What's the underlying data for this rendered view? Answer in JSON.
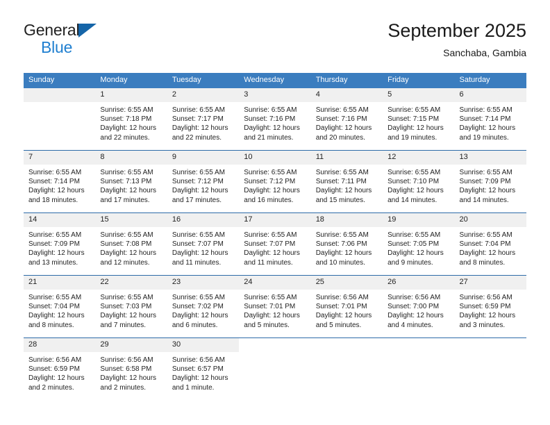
{
  "brand": {
    "name_part1": "General",
    "name_part2": "Blue",
    "logo_icon": "triangle-icon"
  },
  "header": {
    "title": "September 2025",
    "location": "Sanchaba, Gambia"
  },
  "colors": {
    "header_blue": "#3b7dbf",
    "rule_blue": "#2c6aa8",
    "daynum_band": "#f0f0f0",
    "brand_blue": "#1f7fd0",
    "text": "#222222"
  },
  "weekday_headers": [
    "Sunday",
    "Monday",
    "Tuesday",
    "Wednesday",
    "Thursday",
    "Friday",
    "Saturday"
  ],
  "weeks": [
    [
      {
        "day": "",
        "lines": []
      },
      {
        "day": "1",
        "lines": [
          "Sunrise: 6:55 AM",
          "Sunset: 7:18 PM",
          "Daylight: 12 hours",
          "and 22 minutes."
        ]
      },
      {
        "day": "2",
        "lines": [
          "Sunrise: 6:55 AM",
          "Sunset: 7:17 PM",
          "Daylight: 12 hours",
          "and 22 minutes."
        ]
      },
      {
        "day": "3",
        "lines": [
          "Sunrise: 6:55 AM",
          "Sunset: 7:16 PM",
          "Daylight: 12 hours",
          "and 21 minutes."
        ]
      },
      {
        "day": "4",
        "lines": [
          "Sunrise: 6:55 AM",
          "Sunset: 7:16 PM",
          "Daylight: 12 hours",
          "and 20 minutes."
        ]
      },
      {
        "day": "5",
        "lines": [
          "Sunrise: 6:55 AM",
          "Sunset: 7:15 PM",
          "Daylight: 12 hours",
          "and 19 minutes."
        ]
      },
      {
        "day": "6",
        "lines": [
          "Sunrise: 6:55 AM",
          "Sunset: 7:14 PM",
          "Daylight: 12 hours",
          "and 19 minutes."
        ]
      }
    ],
    [
      {
        "day": "7",
        "lines": [
          "Sunrise: 6:55 AM",
          "Sunset: 7:14 PM",
          "Daylight: 12 hours",
          "and 18 minutes."
        ]
      },
      {
        "day": "8",
        "lines": [
          "Sunrise: 6:55 AM",
          "Sunset: 7:13 PM",
          "Daylight: 12 hours",
          "and 17 minutes."
        ]
      },
      {
        "day": "9",
        "lines": [
          "Sunrise: 6:55 AM",
          "Sunset: 7:12 PM",
          "Daylight: 12 hours",
          "and 17 minutes."
        ]
      },
      {
        "day": "10",
        "lines": [
          "Sunrise: 6:55 AM",
          "Sunset: 7:12 PM",
          "Daylight: 12 hours",
          "and 16 minutes."
        ]
      },
      {
        "day": "11",
        "lines": [
          "Sunrise: 6:55 AM",
          "Sunset: 7:11 PM",
          "Daylight: 12 hours",
          "and 15 minutes."
        ]
      },
      {
        "day": "12",
        "lines": [
          "Sunrise: 6:55 AM",
          "Sunset: 7:10 PM",
          "Daylight: 12 hours",
          "and 14 minutes."
        ]
      },
      {
        "day": "13",
        "lines": [
          "Sunrise: 6:55 AM",
          "Sunset: 7:09 PM",
          "Daylight: 12 hours",
          "and 14 minutes."
        ]
      }
    ],
    [
      {
        "day": "14",
        "lines": [
          "Sunrise: 6:55 AM",
          "Sunset: 7:09 PM",
          "Daylight: 12 hours",
          "and 13 minutes."
        ]
      },
      {
        "day": "15",
        "lines": [
          "Sunrise: 6:55 AM",
          "Sunset: 7:08 PM",
          "Daylight: 12 hours",
          "and 12 minutes."
        ]
      },
      {
        "day": "16",
        "lines": [
          "Sunrise: 6:55 AM",
          "Sunset: 7:07 PM",
          "Daylight: 12 hours",
          "and 11 minutes."
        ]
      },
      {
        "day": "17",
        "lines": [
          "Sunrise: 6:55 AM",
          "Sunset: 7:07 PM",
          "Daylight: 12 hours",
          "and 11 minutes."
        ]
      },
      {
        "day": "18",
        "lines": [
          "Sunrise: 6:55 AM",
          "Sunset: 7:06 PM",
          "Daylight: 12 hours",
          "and 10 minutes."
        ]
      },
      {
        "day": "19",
        "lines": [
          "Sunrise: 6:55 AM",
          "Sunset: 7:05 PM",
          "Daylight: 12 hours",
          "and 9 minutes."
        ]
      },
      {
        "day": "20",
        "lines": [
          "Sunrise: 6:55 AM",
          "Sunset: 7:04 PM",
          "Daylight: 12 hours",
          "and 8 minutes."
        ]
      }
    ],
    [
      {
        "day": "21",
        "lines": [
          "Sunrise: 6:55 AM",
          "Sunset: 7:04 PM",
          "Daylight: 12 hours",
          "and 8 minutes."
        ]
      },
      {
        "day": "22",
        "lines": [
          "Sunrise: 6:55 AM",
          "Sunset: 7:03 PM",
          "Daylight: 12 hours",
          "and 7 minutes."
        ]
      },
      {
        "day": "23",
        "lines": [
          "Sunrise: 6:55 AM",
          "Sunset: 7:02 PM",
          "Daylight: 12 hours",
          "and 6 minutes."
        ]
      },
      {
        "day": "24",
        "lines": [
          "Sunrise: 6:55 AM",
          "Sunset: 7:01 PM",
          "Daylight: 12 hours",
          "and 5 minutes."
        ]
      },
      {
        "day": "25",
        "lines": [
          "Sunrise: 6:56 AM",
          "Sunset: 7:01 PM",
          "Daylight: 12 hours",
          "and 5 minutes."
        ]
      },
      {
        "day": "26",
        "lines": [
          "Sunrise: 6:56 AM",
          "Sunset: 7:00 PM",
          "Daylight: 12 hours",
          "and 4 minutes."
        ]
      },
      {
        "day": "27",
        "lines": [
          "Sunrise: 6:56 AM",
          "Sunset: 6:59 PM",
          "Daylight: 12 hours",
          "and 3 minutes."
        ]
      }
    ],
    [
      {
        "day": "28",
        "lines": [
          "Sunrise: 6:56 AM",
          "Sunset: 6:59 PM",
          "Daylight: 12 hours",
          "and 2 minutes."
        ]
      },
      {
        "day": "29",
        "lines": [
          "Sunrise: 6:56 AM",
          "Sunset: 6:58 PM",
          "Daylight: 12 hours",
          "and 2 minutes."
        ]
      },
      {
        "day": "30",
        "lines": [
          "Sunrise: 6:56 AM",
          "Sunset: 6:57 PM",
          "Daylight: 12 hours",
          "and 1 minute."
        ]
      },
      {
        "day": "",
        "lines": []
      },
      {
        "day": "",
        "lines": []
      },
      {
        "day": "",
        "lines": []
      },
      {
        "day": "",
        "lines": []
      }
    ]
  ]
}
